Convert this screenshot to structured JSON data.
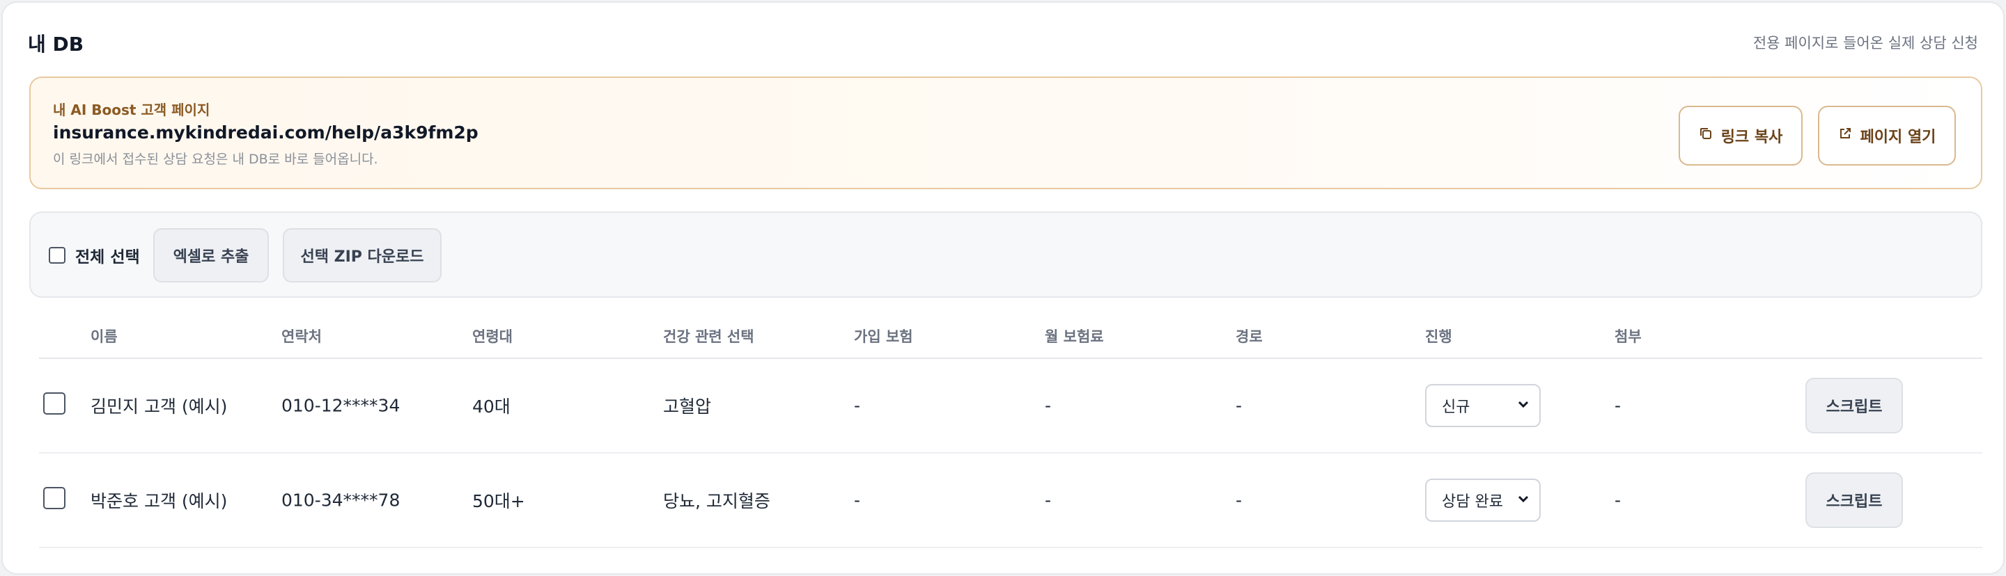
{
  "header": {
    "title": "내 DB",
    "note": "전용 페이지로 들어온 실제 상담 신청"
  },
  "boost": {
    "label": "내 AI Boost 고객 페이지",
    "url": "insurance.mykindredai.com/help/a3k9fm2p",
    "description": "이 링크에서 접수된 상담 요청은 내 DB로 바로 들어옵니다.",
    "copy_label": "링크 복사",
    "copy_icon": "copy-icon",
    "open_label": "페이지 열기",
    "open_icon": "external-link-icon",
    "accent_color": "#8b5a23"
  },
  "toolbar": {
    "select_all_label": "전체 선택",
    "excel_label": "엑셀로 추출",
    "zip_label": "선택 ZIP 다운로드"
  },
  "table": {
    "columns": [
      "이름",
      "연락처",
      "연령대",
      "건강 관련 선택",
      "가입 보험",
      "월 보험료",
      "경로",
      "진행",
      "첨부"
    ],
    "rows": [
      {
        "name": "김민지 고객 (예시)",
        "phone": "010-12****34",
        "age": "40대",
        "health": "고혈압",
        "insurance": "-",
        "premium": "-",
        "source": "-",
        "status": "신규",
        "attachment": "-",
        "script_label": "스크립트"
      },
      {
        "name": "박준호 고객 (예시)",
        "phone": "010-34****78",
        "age": "50대+",
        "health": "당뇨, 고지혈증",
        "insurance": "-",
        "premium": "-",
        "source": "-",
        "status": "상담 완료",
        "attachment": "-",
        "script_label": "스크립트"
      }
    ]
  }
}
